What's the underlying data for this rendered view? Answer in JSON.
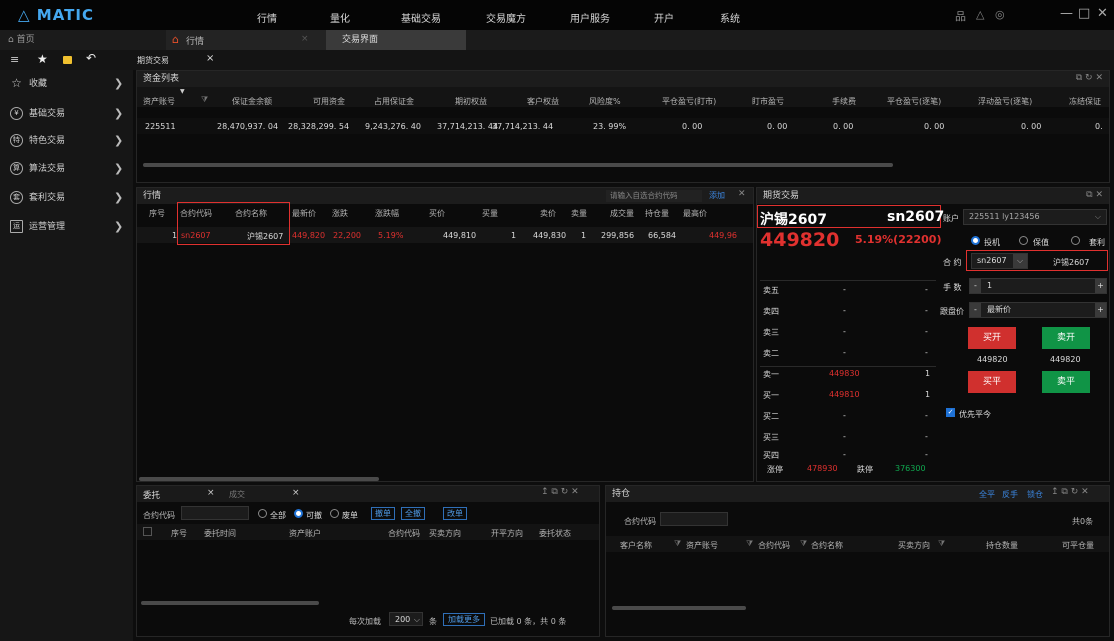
{
  "app": {
    "logo": "MATIC",
    "menu": [
      "行情",
      "量化",
      "基础交易",
      "交易魔方",
      "用户服务",
      "开户",
      "系统"
    ],
    "window_icons": [
      "品",
      "△",
      "◎"
    ],
    "win_controls": [
      "—",
      "□",
      "✕"
    ]
  },
  "tabs": {
    "home": "首页",
    "market": "行情",
    "trading": "交易界面"
  },
  "toolbar": {
    "tab": "期货交易",
    "close": "×"
  },
  "sidebar": [
    {
      "icon": "☆",
      "label": "收藏"
    },
    {
      "icon": "¥",
      "label": "基础交易"
    },
    {
      "icon": "特",
      "label": "特色交易"
    },
    {
      "icon": "算",
      "label": "算法交易"
    },
    {
      "icon": "套",
      "label": "套利交易"
    },
    {
      "icon": "运",
      "label": "运营管理"
    }
  ],
  "funds": {
    "title": "资金列表",
    "headers": [
      "资产账号",
      "保证金余额",
      "可用资金",
      "占用保证金",
      "期初权益",
      "客户权益",
      "风险度%",
      "平仓盈亏(盯市)",
      "盯市盈亏",
      "手续费",
      "平仓盈亏(逐笔)",
      "浮动盈亏(逐笔)",
      "冻结保证"
    ],
    "row": [
      "225511",
      "28,470,937. 04",
      "28,328,299. 54",
      "9,243,276. 40",
      "37,714,213. 44",
      "37,714,213. 44",
      "23. 99%",
      "0. 00",
      "0. 00",
      "0. 00",
      "0. 00",
      "0. 00",
      "0."
    ]
  },
  "quotes": {
    "title": "行情",
    "search_placeholder": "请输入自选合约代码",
    "add": "添加",
    "close": "✕",
    "headers": [
      "序号",
      "合约代码",
      "合约名称",
      "最新价",
      "涨跌",
      "涨跌幅",
      "买价",
      "买量",
      "卖价",
      "卖量",
      "成交量",
      "持仓量",
      "最高价"
    ],
    "row": [
      "1",
      "sn2607",
      "沪锡2607",
      "449,820",
      "22,200",
      "5.19%",
      "449,810",
      "1",
      "449,830",
      "1",
      "299,856",
      "66,584",
      "449,96"
    ]
  },
  "order": {
    "title": "期货交易",
    "name": "沪锡2607",
    "code": "sn2607",
    "price": "449820",
    "change": "5.19%(22200)",
    "book": [
      {
        "label": "卖五",
        "price": "-",
        "vol": "-"
      },
      {
        "label": "卖四",
        "price": "-",
        "vol": "-"
      },
      {
        "label": "卖三",
        "price": "-",
        "vol": "-"
      },
      {
        "label": "卖二",
        "price": "-",
        "vol": "-"
      },
      {
        "label": "卖一",
        "price": "449830",
        "vol": "1"
      },
      {
        "label": "买一",
        "price": "449810",
        "vol": "1"
      },
      {
        "label": "买二",
        "price": "-",
        "vol": "-"
      },
      {
        "label": "买三",
        "price": "-",
        "vol": "-"
      },
      {
        "label": "买四",
        "price": "-",
        "vol": "-"
      },
      {
        "label": "买五",
        "price": "-",
        "vol": "-"
      }
    ],
    "limit_up_label": "涨停",
    "limit_up": "478930",
    "limit_down_label": "跌停",
    "limit_down": "376300",
    "account_label": "账户",
    "account": "225511 ly123456",
    "radios": [
      "投机",
      "保值",
      "套利"
    ],
    "contract_label": "合 约",
    "contract_code": "sn2607",
    "contract_name": "沪锡2607",
    "lots_label": "手 数",
    "lots": "1",
    "price_label": "跟盘价",
    "price_type": "最新价",
    "buy_open": "买开",
    "sell_open": "卖开",
    "buy_price": "449820",
    "sell_price": "449820",
    "buy_close": "买平",
    "sell_close": "卖平",
    "priority": "优先平今"
  },
  "entrust": {
    "tab1": "委托",
    "tab2": "成交",
    "contract_label": "合约代码",
    "filters": [
      "全部",
      "可撤",
      "废单"
    ],
    "buttons": [
      "撤单",
      "全撤",
      "改单"
    ],
    "headers": [
      "序号",
      "委托时间",
      "资产账户",
      "合约代码",
      "买卖方向",
      "开平方向",
      "委托状态"
    ],
    "footer_prefix": "每次加载",
    "page_size": "200",
    "footer_unit": "条",
    "load_more": "加载更多",
    "footer_status": "已加载 0 条，共 0 条"
  },
  "position": {
    "title": "持仓",
    "actions": [
      "全平",
      "反手",
      "锁仓"
    ],
    "contract_label": "合约代码",
    "count": "共0条",
    "headers": [
      "客户名称",
      "资产账号",
      "合约代码",
      "合约名称",
      "买卖方向",
      "持仓数量",
      "可平仓量"
    ]
  },
  "colors": {
    "red": "#e0312f",
    "green": "#10a850",
    "blue": "#1f72d6",
    "orange": "#d9a43a"
  }
}
